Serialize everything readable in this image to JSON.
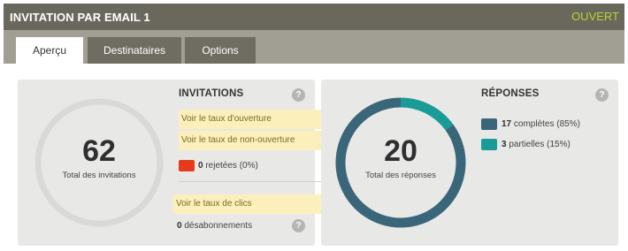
{
  "header": {
    "title": "INVITATION PAR EMAIL 1",
    "status": "OUVERT",
    "status_color": "#b8d431"
  },
  "tabs": [
    {
      "label": "Aperçu",
      "active": true
    },
    {
      "label": "Destinataires",
      "active": false
    },
    {
      "label": "Options",
      "active": false
    }
  ],
  "invitations": {
    "total": "62",
    "total_caption": "Total des invitations",
    "section_title": "INVITATIONS",
    "help_icon": "?",
    "links": {
      "open_rate": "Voir le taux d'ouverture",
      "non_open_rate": "Voir le taux de non-ouverture",
      "click_rate": "Voir le taux de clics"
    },
    "rejected_count": "0",
    "rejected_label": "rejetées (0%)",
    "rejected_color": "#e63a1c",
    "unsubscribed_count": "0",
    "unsubscribed_label": "désabonnements"
  },
  "responses": {
    "total": "20",
    "total_caption": "Total des réponses",
    "section_title": "RÉPONSES",
    "help_icon": "?",
    "complete_count": "17",
    "complete_label": "complètes (85%)",
    "complete_pct": 85,
    "complete_color": "#3a6679",
    "partial_count": "3",
    "partial_label": "partielles (15%)",
    "partial_pct": 15,
    "partial_color": "#1a9b98"
  }
}
